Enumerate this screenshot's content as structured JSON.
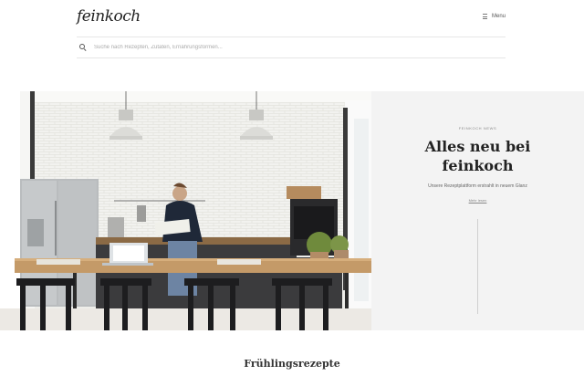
{
  "header": {
    "logo_text": "feinkoch",
    "menu_label": "Menu"
  },
  "search": {
    "placeholder": "Suche nach Rezepten, Zutaten, Ernährungsformen..."
  },
  "hero": {
    "kicker": "FEINKOCH NEWS",
    "title_line1": "Alles neu bei",
    "title_line2": "feinkoch",
    "subtitle": "Unsere Rezeptplattform erstrahlt in neuem Glanz",
    "link_label": "Mehr lesen",
    "image_alt": "Mann liest Zeitschrift in moderner Küche"
  },
  "section": {
    "title": "Frühlingsrezepte"
  },
  "colors": {
    "panel_bg": "#f3f3f3",
    "wall": "#f1f1ee",
    "wood": "#c49a68"
  }
}
